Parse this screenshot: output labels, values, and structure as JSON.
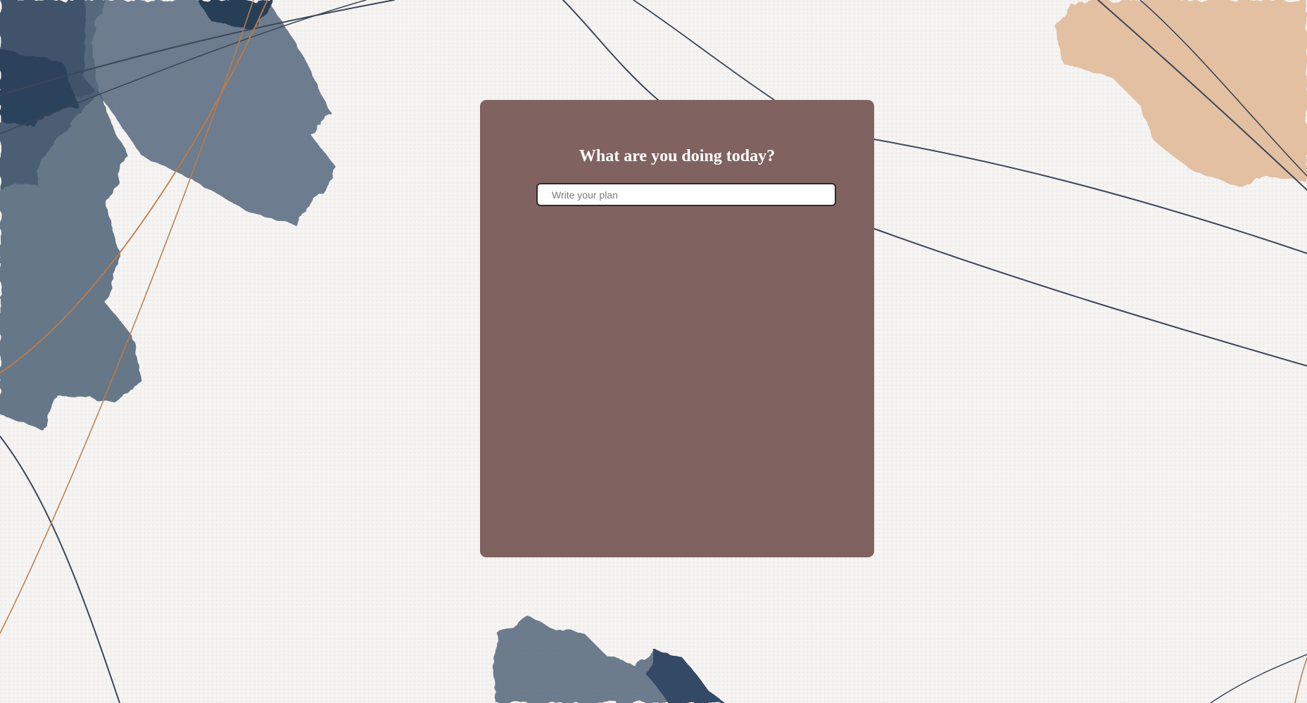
{
  "todo": {
    "title": "What are you doing today?",
    "input_value": "",
    "input_placeholder": "Write your plan"
  },
  "colors": {
    "card": "#806360",
    "title": "#ffffff",
    "background": "#f3f2f1",
    "ink_navy": "#3c5068",
    "ink_peach": "#e2b994",
    "line_copper": "#c27a46"
  }
}
